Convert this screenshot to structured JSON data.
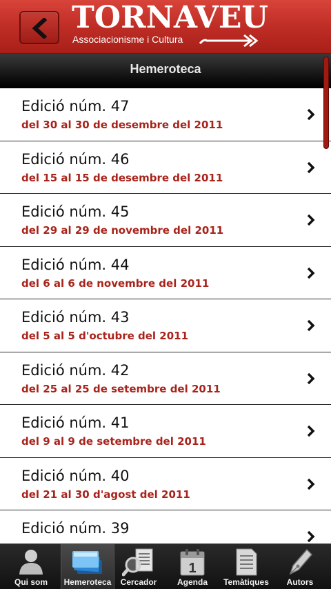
{
  "header": {
    "brand_title": "TORNAVEU",
    "brand_subtitle": "Associacionisme i Cultura"
  },
  "title_bar": {
    "title": "Hemeroteca"
  },
  "editions": [
    {
      "title": "Edició núm. 47",
      "dates": "del 30 al 30 de desembre del 2011"
    },
    {
      "title": "Edició núm. 46",
      "dates": "del 15 al 15 de desembre del 2011"
    },
    {
      "title": "Edició núm. 45",
      "dates": "del 29 al 29 de novembre del 2011"
    },
    {
      "title": "Edició núm. 44",
      "dates": "del 6 al 6 de novembre del 2011"
    },
    {
      "title": "Edició núm. 43",
      "dates": "del 5 al 5 d'octubre del 2011"
    },
    {
      "title": "Edició núm. 42",
      "dates": "del 25 al 25 de setembre del 2011"
    },
    {
      "title": "Edició núm. 41",
      "dates": "del 9 al 9 de setembre del 2011"
    },
    {
      "title": "Edició núm. 40",
      "dates": "del 21 al 30 d'agost del 2011"
    },
    {
      "title": "Edició núm. 39",
      "dates": ""
    }
  ],
  "tabs": [
    {
      "label": "Qui som",
      "icon": "person-icon"
    },
    {
      "label": "Hemeroteca",
      "icon": "stack-icon",
      "active": true
    },
    {
      "label": "Cercador",
      "icon": "search-document-icon"
    },
    {
      "label": "Agenda",
      "icon": "calendar-icon"
    },
    {
      "label": "Temàtiques",
      "icon": "document-icon"
    },
    {
      "label": "Autors",
      "icon": "pen-nib-icon"
    }
  ],
  "colors": {
    "header_red": "#c12f27",
    "accent_text": "#a8231b"
  }
}
